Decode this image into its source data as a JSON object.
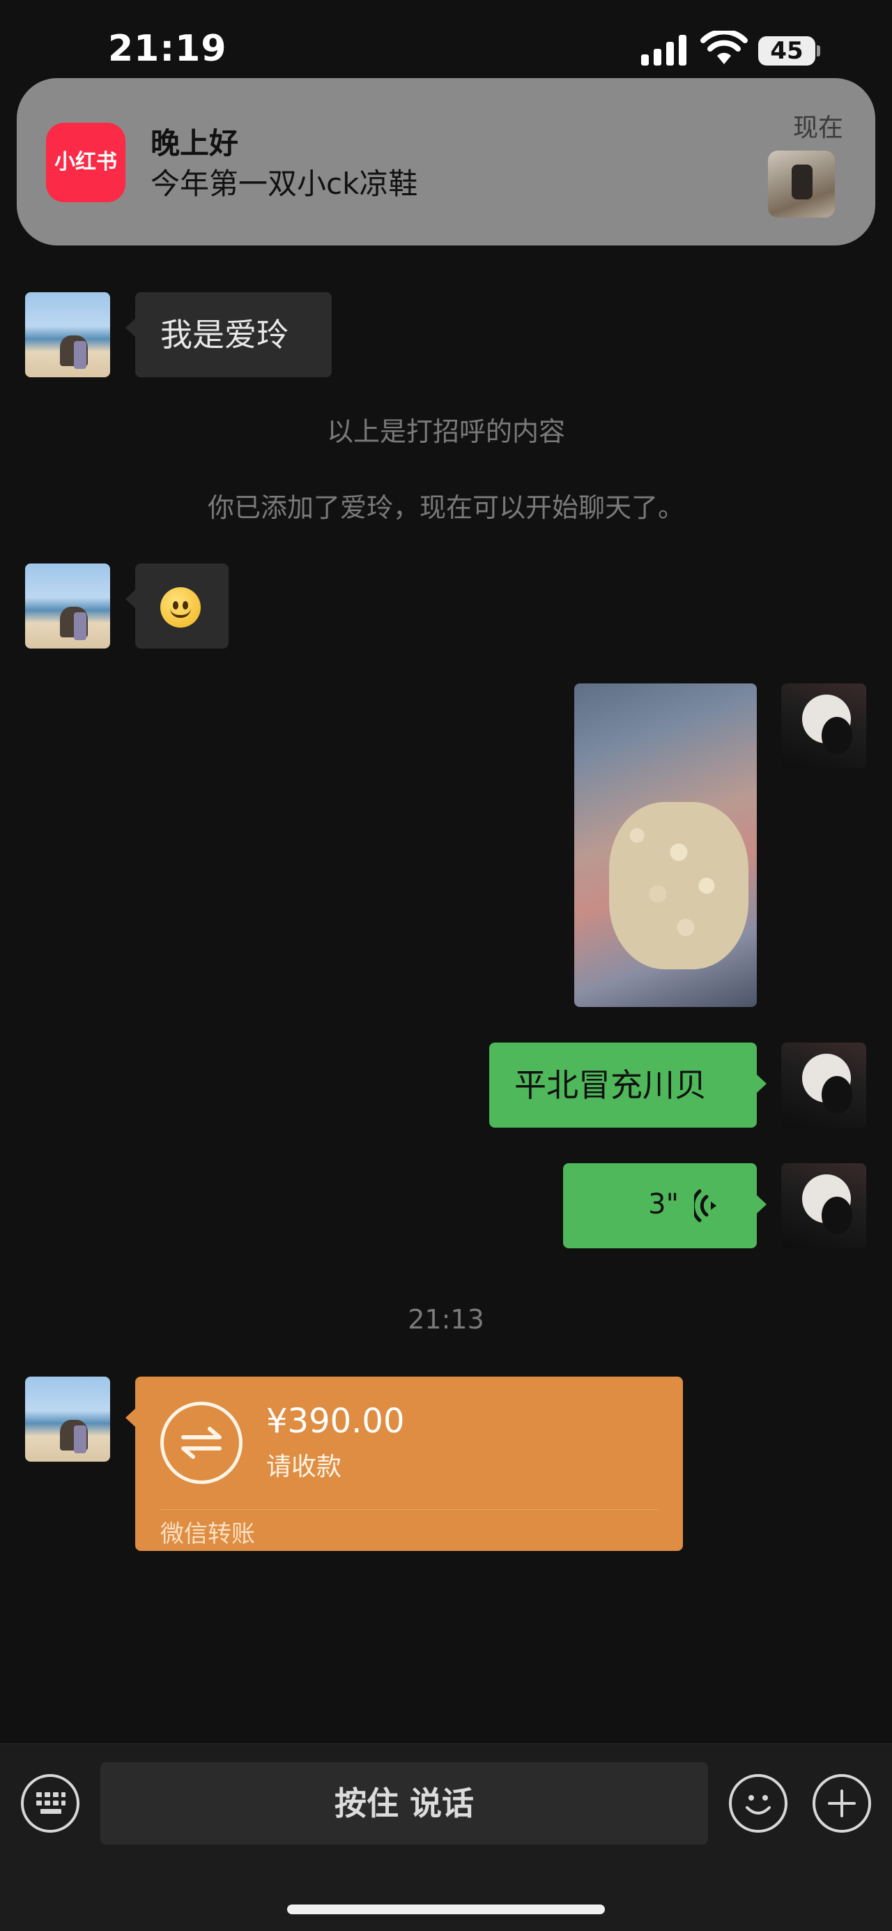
{
  "status_bar": {
    "time": "21:19",
    "battery": "45"
  },
  "notification": {
    "app_icon_text": "小红书",
    "title": "晚上好",
    "body": "今年第一双小ck凉鞋",
    "time": "现在"
  },
  "messages": {
    "greeting_text": "我是爱玲",
    "system_greeting_note": "以上是打招呼的内容",
    "system_added_note": "你已添加了爱玲，现在可以开始聊天了。",
    "sent_text": "平北冒充川贝",
    "voice_duration": "3\"",
    "timestamp": "21:13",
    "transfer": {
      "amount": "¥390.00",
      "subtitle": "请收款",
      "footer": "微信转账"
    }
  },
  "input_bar": {
    "talk_label": "按住 说话"
  },
  "colors": {
    "background": "#111111",
    "incoming_bubble": "#2c2c2c",
    "outgoing_bubble": "#4fb85a",
    "transfer_card": "#de8d42",
    "notification_icon": "#fb2a46"
  },
  "icons": [
    "signal-icon",
    "wifi-icon",
    "battery-icon",
    "voice-wave-icon",
    "transfer-arrows-icon",
    "keyboard-icon",
    "emoji-icon",
    "plus-icon"
  ]
}
